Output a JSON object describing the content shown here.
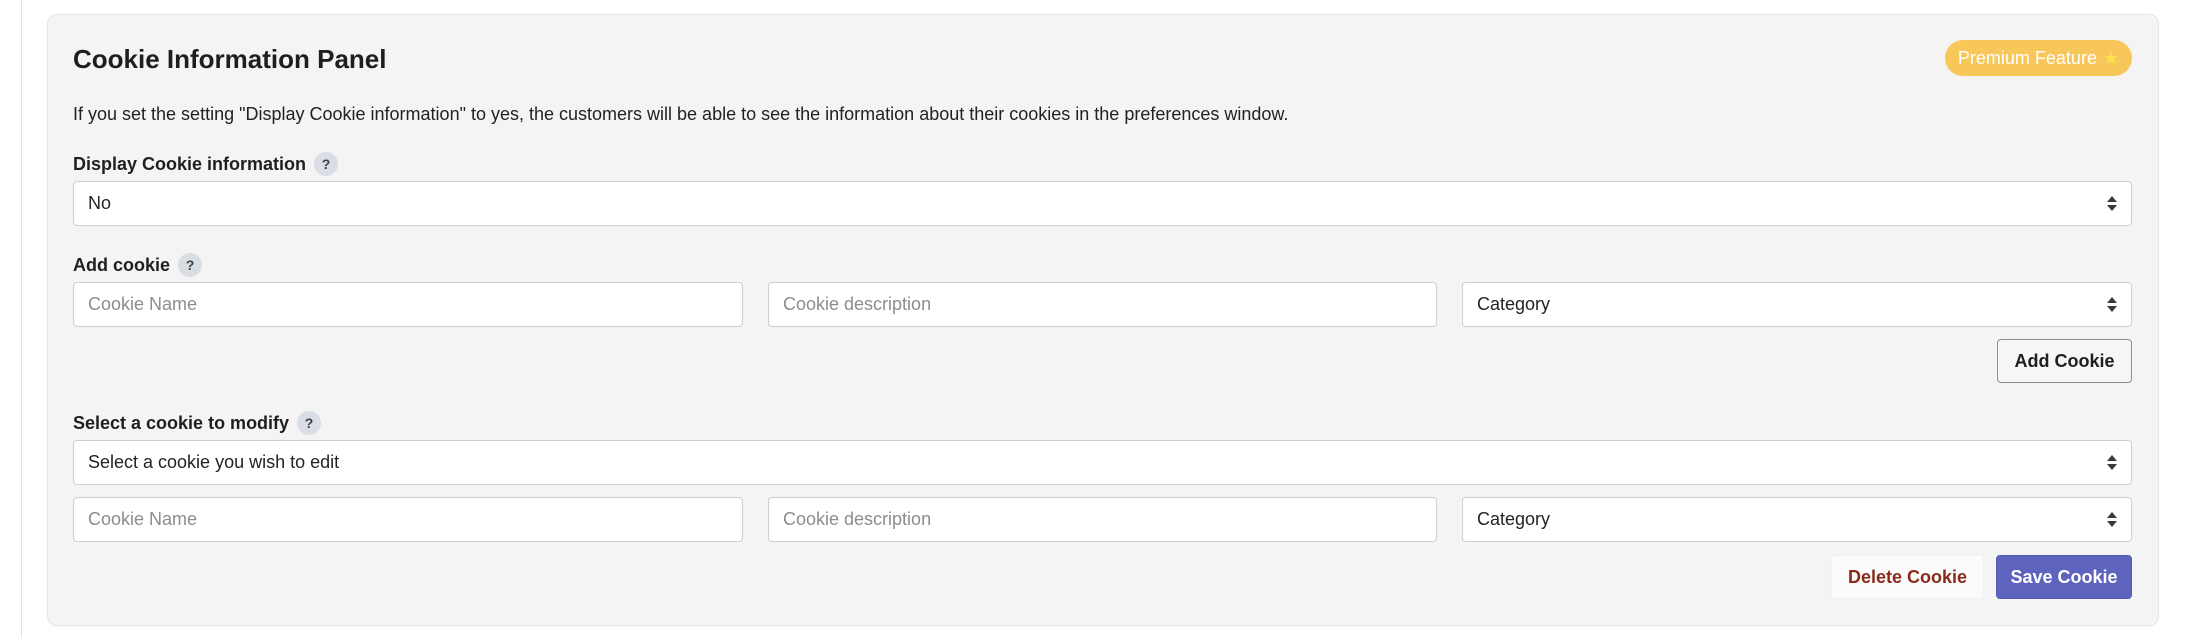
{
  "panel": {
    "title": "Cookie Information Panel",
    "premium_badge": "Premium Feature",
    "premium_icon": "star-icon",
    "intro": "If you set the setting \"Display Cookie information\" to yes, the customers will be able to see the information about their cookies in the preferences window."
  },
  "display_info": {
    "label": "Display Cookie information",
    "help": "?",
    "value": "No"
  },
  "add_cookie": {
    "label": "Add cookie",
    "help": "?",
    "name_placeholder": "Cookie Name",
    "description_placeholder": "Cookie description",
    "category_value": "Category",
    "button": "Add Cookie"
  },
  "modify_cookie": {
    "label": "Select a cookie to modify",
    "help": "?",
    "select_value": "Select a cookie you wish to edit",
    "name_placeholder": "Cookie Name",
    "description_placeholder": "Cookie description",
    "category_value": "Category",
    "delete_button": "Delete Cookie",
    "save_button": "Save Cookie"
  },
  "colors": {
    "premium": "#f7c75a",
    "save": "#5e64bd",
    "delete_text": "#8a2b1b",
    "panel_bg": "#f4f4f4"
  }
}
